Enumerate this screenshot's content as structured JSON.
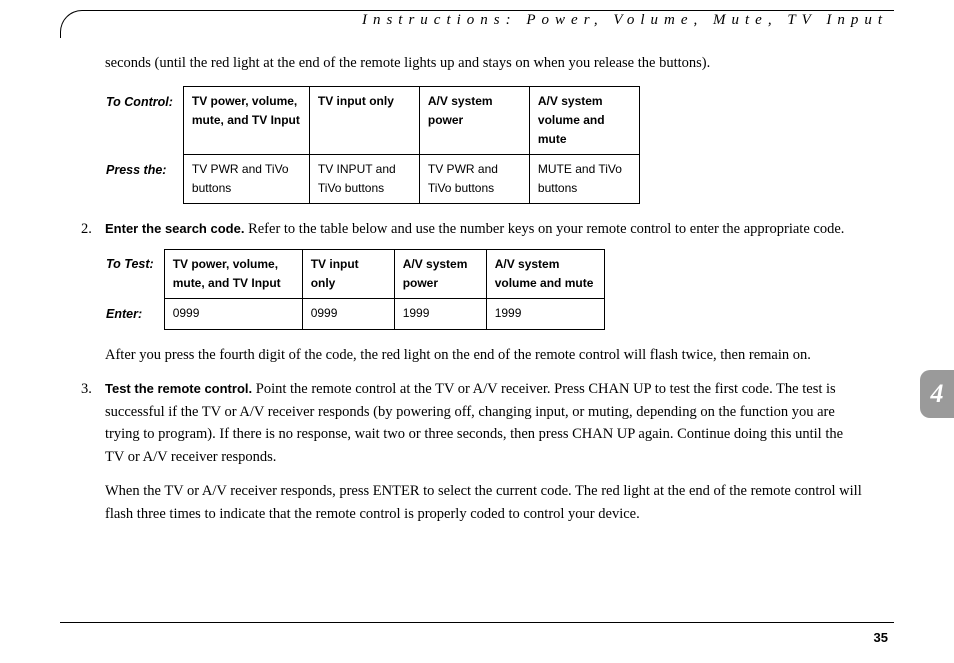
{
  "header": "Instructions: Power, Volume, Mute, TV Input",
  "chapter_tab": "4",
  "page_number": "35",
  "intro_para": "seconds (until the red light at the end of the remote lights up and stays on when you release the buttons).",
  "table1": {
    "row1_label": "To Control:",
    "row2_label": "Press the:",
    "cols": [
      {
        "h": "TV power, volume, mute, and TV Input",
        "v": "TV PWR and TiVo buttons"
      },
      {
        "h": "TV input only",
        "v": "TV INPUT and TiVo buttons"
      },
      {
        "h": "A/V system power",
        "v": "TV PWR and TiVo buttons"
      },
      {
        "h": "A/V system volume and mute",
        "v": "MUTE and TiVo buttons"
      }
    ]
  },
  "step2": {
    "num": "2.",
    "lead": "Enter the search code.",
    "rest": " Refer to the table below and use the number keys on your remote control to enter the appropriate code."
  },
  "table2": {
    "row1_label": "To Test:",
    "row2_label": "Enter:",
    "cols": [
      {
        "h": "TV power, volume, mute, and TV Input",
        "v": "0999"
      },
      {
        "h": "TV input only",
        "v": "0999"
      },
      {
        "h": "A/V system power",
        "v": "1999"
      },
      {
        "h": "A/V system volume and mute",
        "v": "1999"
      }
    ]
  },
  "after_table2": "After you press the fourth digit of the code, the red light on the end of the remote control will flash twice, then remain on.",
  "step3": {
    "num": "3.",
    "lead": "Test the remote control.",
    "rest": " Point the remote control at the TV or A/V receiver. Press CHAN UP to test the first code. The test is successful if the TV or A/V receiver responds (by powering off, changing input, or muting, depending on the function you are trying to program). If there is no response, wait two or three seconds, then press CHAN UP again. Continue doing this until the TV or A/V receiver responds."
  },
  "after_step3": "When the TV or A/V receiver responds, press ENTER to select the current code. The red light at the end of the remote control will flash three times to indicate that the remote control is properly coded to control your device."
}
